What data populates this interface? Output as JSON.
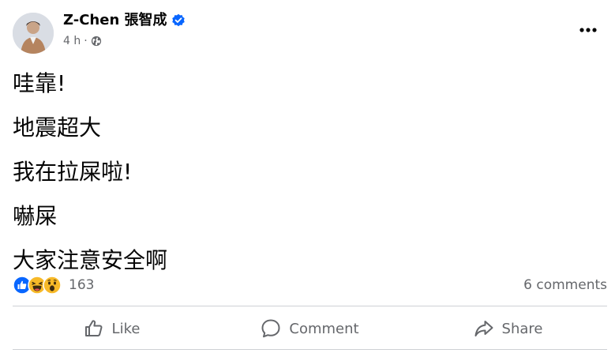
{
  "author": {
    "name": "Z-Chen 張智成",
    "verified": true,
    "timestamp": "4 h",
    "separator": "·",
    "audience_icon": "globe-icon"
  },
  "menu": {
    "icon": "more-horizontal-icon"
  },
  "post": {
    "lines": [
      "哇靠!",
      "地震超大",
      "我在拉屎啦!",
      "嚇屎",
      "大家注意安全啊"
    ]
  },
  "reactions": {
    "icons": [
      "like-reaction-icon",
      "haha-reaction-icon",
      "wow-reaction-icon"
    ],
    "count": "163"
  },
  "comments": {
    "label": "6 comments"
  },
  "actions": {
    "like": "Like",
    "comment": "Comment",
    "share": "Share"
  },
  "colors": {
    "text": "#050505",
    "secondary": "#65676b",
    "brand_blue": "#0866ff",
    "reaction_yellow": "#f7b928",
    "divider": "#ced0d4"
  }
}
